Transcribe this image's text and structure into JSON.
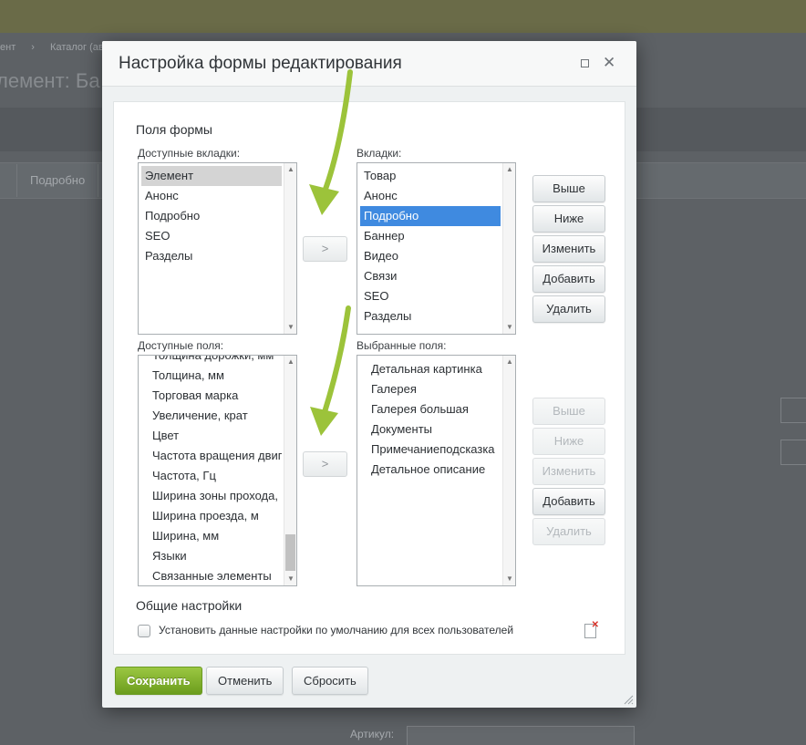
{
  "background": {
    "breadcrumbs": [
      "ент",
      "›",
      "Каталог (авт"
    ],
    "page_title": "лемент: Ба",
    "tab_label": "Подробно",
    "field_label": "Артикул:"
  },
  "dialog": {
    "title": "Настройка формы редактирования",
    "form_fields_heading": "Поля формы",
    "available_tabs_label": "Доступные вкладки:",
    "available_tabs": [
      "Элемент",
      "Анонс",
      "Подробно",
      "SEO",
      "Разделы"
    ],
    "tabs_label": "Вкладки:",
    "tabs": [
      "Товар",
      "Анонс",
      "Подробно",
      "Баннер",
      "Видео",
      "Связи",
      "SEO",
      "Разделы"
    ],
    "move_button": ">",
    "tab_buttons": {
      "up": "Выше",
      "down": "Ниже",
      "edit": "Изменить",
      "add": "Добавить",
      "delete": "Удалить"
    },
    "available_fields_label": "Доступные поля:",
    "available_fields": [
      "Толщина дорожки, мм",
      "Толщина, мм",
      "Торговая марка",
      "Увеличение, крат",
      "Цвет",
      "Частота вращения двигателя",
      "Частота, Гц",
      "Ширина зоны прохода, м",
      "Ширина проезда, м",
      "Ширина, мм",
      "Языки",
      "Связанные элементы"
    ],
    "selected_fields_label": "Выбранные поля:",
    "selected_fields": [
      "Детальная картинка",
      "Галерея",
      "Галерея большая",
      "Документы",
      "Примечаниеподсказка",
      "Детальное описание"
    ],
    "field_buttons": {
      "up": "Выше",
      "down": "Ниже",
      "edit": "Изменить",
      "add": "Добавить",
      "delete": "Удалить"
    },
    "general_settings_heading": "Общие настройки",
    "default_checkbox_label": "Установить данные настройки по умолчанию для всех пользователей",
    "save_button": "Сохранить",
    "cancel_button": "Отменить",
    "reset_button": "Сбросить",
    "close_symbol": "✕"
  },
  "colors": {
    "accent": "#3f8ae0",
    "save_green": "#7fb22b",
    "arrow_green": "#9cc33a"
  }
}
